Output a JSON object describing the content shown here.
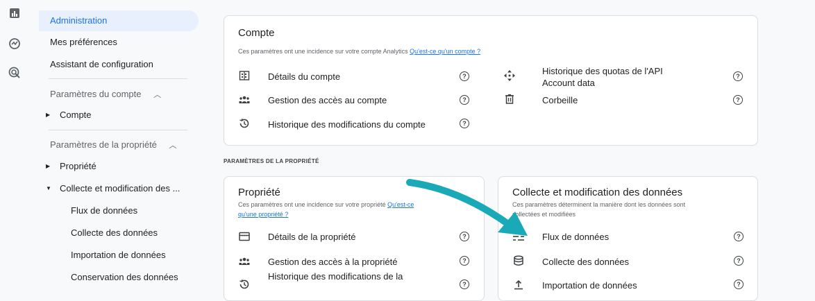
{
  "rail": {
    "icons": [
      "bar-chart-icon",
      "explore-icon",
      "advertising-icon"
    ]
  },
  "nav": {
    "administration": "Administration",
    "preferences": "Mes préférences",
    "setup_assistant": "Assistant de configuration",
    "account_settings": "Paramètres du compte",
    "account": "Compte",
    "property_settings": "Paramètres de la propriété",
    "property": "Propriété",
    "data_collection_modification": "Collecte et modification des ...",
    "sub_items": [
      "Flux de données",
      "Collecte des données",
      "Importation de données",
      "Conservation des données"
    ]
  },
  "account_card": {
    "title": "Compte",
    "description": "Ces paramètres ont une incidence sur votre compte Analytics ",
    "link": "Qu'est-ce qu'un compte ?",
    "rows_left": [
      "Détails du compte",
      "Gestion des accès au compte",
      "Historique des modifications du compte"
    ],
    "rows_right": [
      "Historique des quotas de l'API Account data",
      "Corbeille"
    ]
  },
  "section_label": "PARAMÈTRES DE LA PROPRIÉTÉ",
  "property_card": {
    "title": "Propriété",
    "description": "Ces paramètres ont une incidence sur votre propriété ",
    "link_part1": "Qu'est-ce",
    "link_part2": "qu'une propriété ?",
    "rows": [
      "Détails de la propriété",
      "Gestion des accès à la propriété",
      "Historique des modifications de la"
    ]
  },
  "data_card": {
    "title": "Collecte et modification des données",
    "description_line1": "Ces paramètres déterminent la manière dont les données sont",
    "description_line2": "collectées et modifiées",
    "rows": [
      "Flux de données",
      "Collecte des données",
      "Importation de données"
    ]
  },
  "help_glyph": "?",
  "colors": {
    "accent": "#1a73e8",
    "arrow": "#1aa9b7",
    "active_bg": "#e8f0fe"
  }
}
